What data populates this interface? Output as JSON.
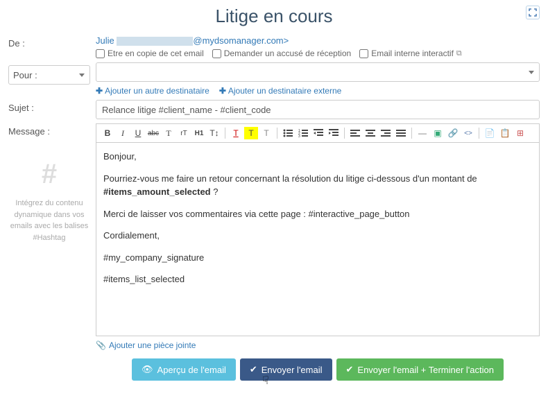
{
  "header": {
    "title": "Litige en cours"
  },
  "from": {
    "label": "De :",
    "name": "Julie",
    "domain": "@mydsomanager.com>",
    "cc_label": "Etre en copie de cet email",
    "receipt_label": "Demander un accusé de réception",
    "internal_label": "Email interne interactif"
  },
  "to": {
    "label": "Pour :",
    "add_other": "Ajouter un autre destinataire",
    "add_external": "Ajouter un destinataire externe"
  },
  "subject": {
    "label": "Sujet :",
    "value": "Relance litige #client_name - #client_code"
  },
  "message": {
    "label": "Message :",
    "hint_title": "#",
    "hint_text": "Intégrez du contenu dynamique dans vos emails avec les balises #Hashtag",
    "body_lines": {
      "greeting": "Bonjour,",
      "l1a": "Pourriez-vous me faire un retour concernant la résolution du litige ci-dessous d'un montant de ",
      "l1b": "#items_amount_selected",
      "l1c": " ?",
      "l2": "Merci de laisser vos commentaires via cette page : #interactive_page_button",
      "l3": "Cordialement,",
      "l4": "#my_company_signature",
      "l5": "#items_list_selected"
    }
  },
  "attach": {
    "label": "Ajouter une pièce jointe"
  },
  "buttons": {
    "preview": "Aperçu de l'email",
    "send": "Envoyer l'email",
    "complete": "Envoyer l'email + Terminer l'action"
  },
  "toolbar": {
    "bold": "B",
    "italic": "I",
    "underline": "U",
    "strike": "abc",
    "font_t1": "T",
    "font_t2": "rT",
    "h1": "H1",
    "size": "T↕",
    "color": "T",
    "bg": "T",
    "clear": "T",
    "ul": "≡",
    "ol": "≡",
    "outdent": "⇤",
    "indent": "⇥",
    "al": "≡",
    "ac": "≡",
    "ar": "≡",
    "aj": "≡",
    "hr": "—",
    "img": "▣",
    "link": "🔗",
    "src": "<>",
    "tpl": "📄",
    "paste": "📋",
    "merge": "⊞"
  }
}
